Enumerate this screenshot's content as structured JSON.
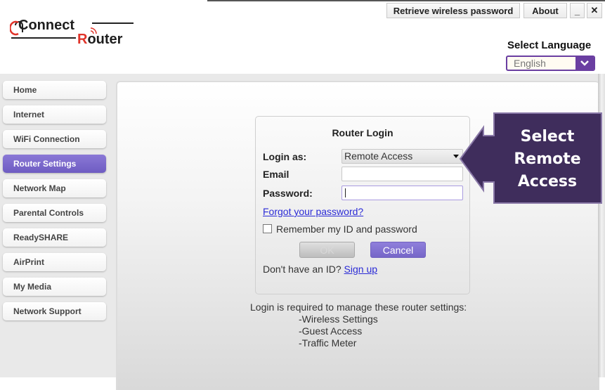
{
  "app": {
    "logo": {
      "part1": "Connect",
      "part2": "Router"
    }
  },
  "toolbar": {
    "retrieve_label": "Retrieve wireless password",
    "about_label": "About",
    "minimize_label": "_",
    "close_label": "✕"
  },
  "language": {
    "title": "Select Language",
    "selected": "English"
  },
  "sidebar": {
    "items": [
      {
        "label": "Home",
        "active": false
      },
      {
        "label": "Internet",
        "active": false
      },
      {
        "label": "WiFi Connection",
        "active": false
      },
      {
        "label": "Router Settings",
        "active": true
      },
      {
        "label": "Network Map",
        "active": false
      },
      {
        "label": "Parental Controls",
        "active": false
      },
      {
        "label": "ReadySHARE",
        "active": false
      },
      {
        "label": "AirPrint",
        "active": false
      },
      {
        "label": "My Media",
        "active": false
      },
      {
        "label": "Network Support",
        "active": false
      }
    ]
  },
  "login": {
    "title": "Router Login",
    "login_as_label": "Login as:",
    "login_as_value": "Remote Access",
    "email_label": "Email",
    "email_value": "",
    "password_label": "Password:",
    "password_value": "",
    "forgot_link": "Forgot your password?",
    "remember_label": "Remember my ID and password",
    "remember_checked": false,
    "ok_label": "OK",
    "cancel_label": "Cancel",
    "no_id_text": "Don't have an ID?",
    "signup_link": "Sign up"
  },
  "info": {
    "heading": "Login is required to manage these router settings:",
    "items": [
      "-Wireless Settings",
      "-Guest Access",
      "-Traffic Meter"
    ]
  },
  "callout": {
    "lines": [
      "Select",
      "Remote",
      "Access"
    ],
    "color": "#3f2d5c"
  },
  "colors": {
    "accent": "#6e5cc2",
    "brand_red": "#e0342a",
    "link": "#2b2bd6"
  }
}
